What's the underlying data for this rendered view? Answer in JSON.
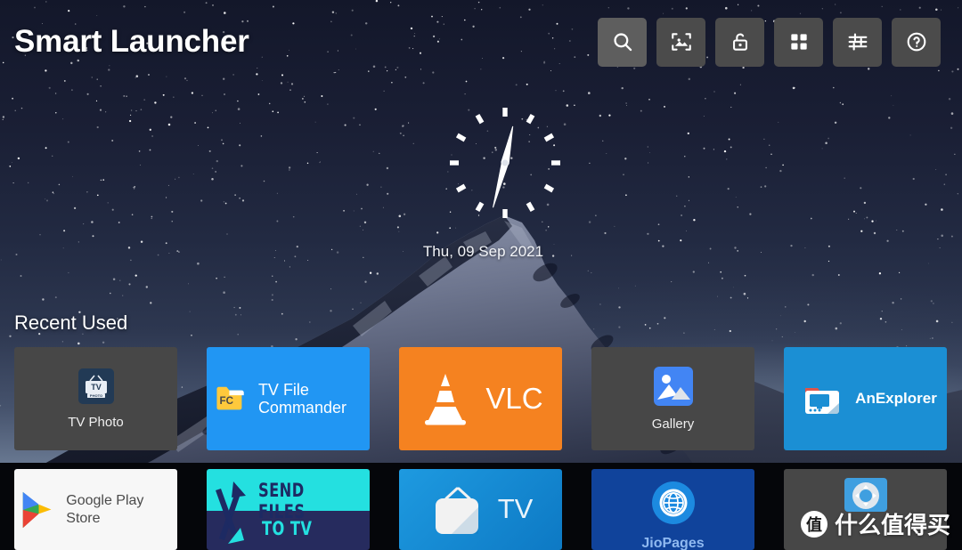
{
  "app": {
    "title": "Smart Launcher"
  },
  "topbar": {
    "icons": [
      {
        "name": "search-icon",
        "label": "Search",
        "focused": true
      },
      {
        "name": "wallpaper-icon",
        "label": "Wallpaper",
        "focused": false
      },
      {
        "name": "lock-icon",
        "label": "Lock",
        "focused": false
      },
      {
        "name": "apps-grid-icon",
        "label": "All Apps",
        "focused": false
      },
      {
        "name": "settings-sliders-icon",
        "label": "Settings",
        "focused": false
      },
      {
        "name": "help-icon",
        "label": "Help",
        "focused": false
      }
    ]
  },
  "clock": {
    "date": "Thu, 09 Sep 2021",
    "hour_hand_deg": 12,
    "minute_hand_deg": 195,
    "ticks": 12
  },
  "recent": {
    "section_label": "Recent Used",
    "row1": [
      {
        "label": "TV Photo",
        "style": "dark",
        "icon": "tv-photo-icon",
        "accent": "#474747"
      },
      {
        "label": "TV File Commander",
        "style": "banner",
        "icon": "fc-folder-icon",
        "accent": "#2196f3"
      },
      {
        "label": "VLC",
        "style": "banner",
        "icon": "vlc-cone-icon",
        "accent": "#f58220"
      },
      {
        "label": "Gallery",
        "style": "dark",
        "icon": "gallery-photo-icon",
        "accent": "#474747"
      },
      {
        "label": "AnExplorer",
        "style": "banner",
        "icon": "anexplorer-icon",
        "accent": "#1b8fd4"
      }
    ],
    "row2": [
      {
        "label": "Google Play Store",
        "style": "play",
        "icon": "play-store-icon",
        "accent": "#f7f7f7"
      },
      {
        "label": "SEND FILES TO TV",
        "style": "sendfiles",
        "icon": "send-files-arrows-icon",
        "accent": "#24e0e0",
        "line1": "SEND FILES",
        "line2": "TO TV"
      },
      {
        "label": "TV",
        "style": "banner",
        "icon": "retro-tv-icon",
        "accent": "#1084d0"
      },
      {
        "label": "JioPages",
        "style": "jio",
        "icon": "globe-icon",
        "accent": "#10439b"
      },
      {
        "label": "",
        "style": "dark",
        "icon": "remote-control-icon",
        "accent": "#474747"
      }
    ]
  },
  "watermark": {
    "badge": "值",
    "text": "什么值得买"
  }
}
